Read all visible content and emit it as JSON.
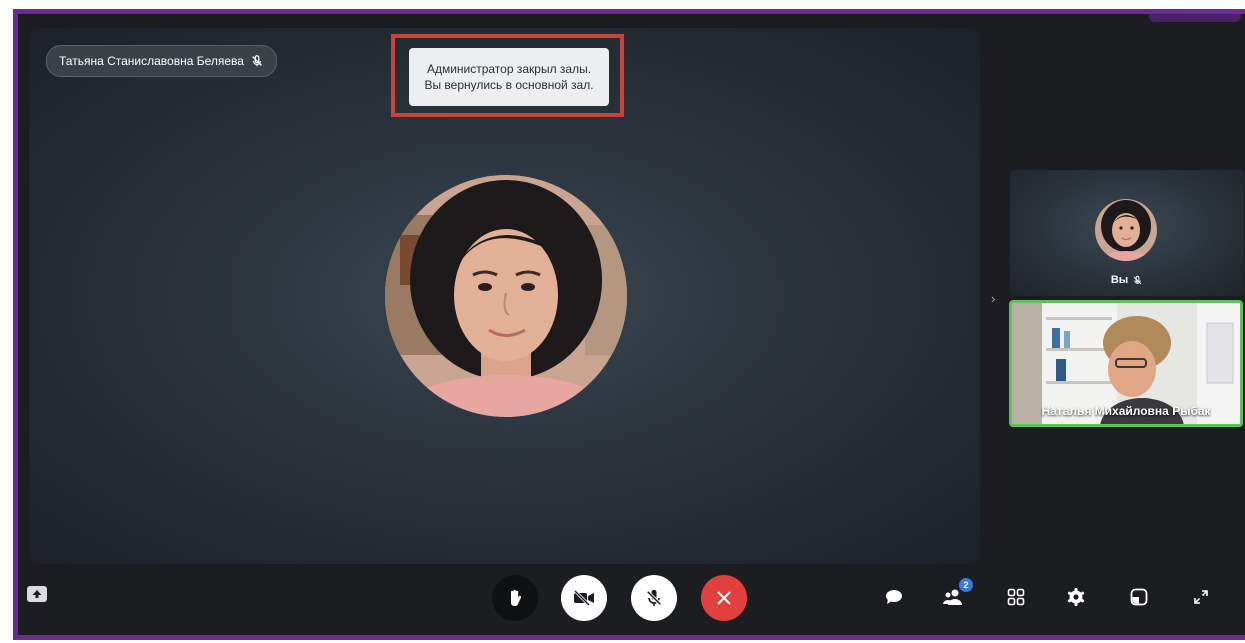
{
  "stage": {
    "speaker_name": "Татьяна Станиславовна Беляева",
    "speaker_mic_icon": "mic-off-icon"
  },
  "notification": {
    "line1": "Администратор закрыл залы.",
    "line2": "Вы вернулись в основной зал.",
    "highlight_color": "#c9433a"
  },
  "sidebar": {
    "self_label": "Вы",
    "remote_name": "Наталья Михайловна Рыбак",
    "active_speaker_color": "#5bc35a"
  },
  "toolbar": {
    "participants_count": "2",
    "end_call_color": "#e2403d",
    "frame_color": "#6b2a94",
    "icons": [
      "screen-share-icon",
      "raise-hand-icon",
      "camera-off-icon",
      "mic-off-icon",
      "hang-up-icon",
      "chat-icon",
      "participants-icon",
      "grid-layout-icon",
      "settings-icon",
      "picture-in-picture-icon",
      "fullscreen-icon"
    ]
  }
}
